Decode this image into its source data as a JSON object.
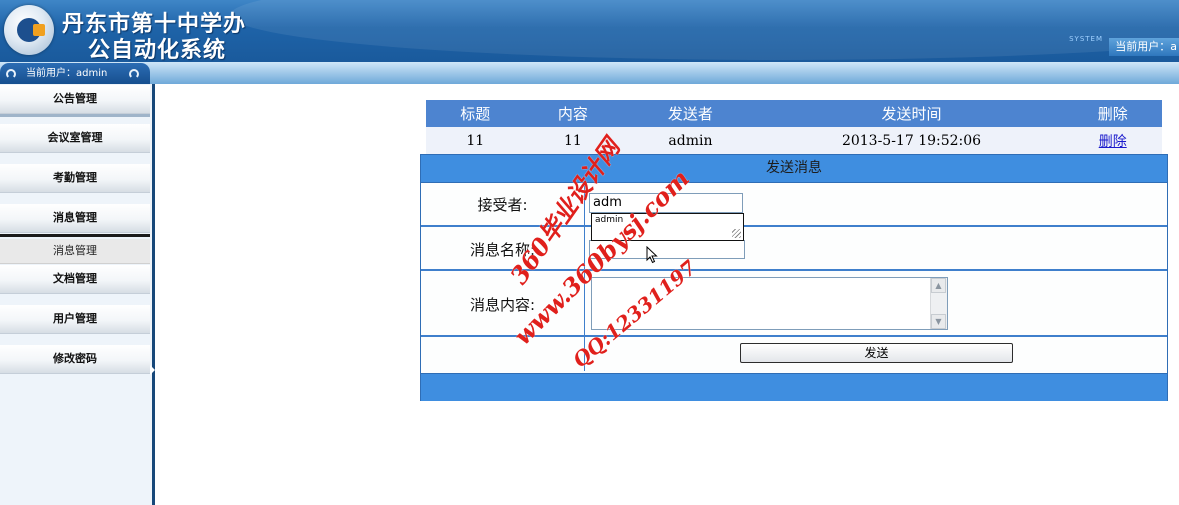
{
  "header": {
    "title_line1": "丹东市第十中学办",
    "title_line2": "公自动化系统",
    "system_badge": "SYSTEM",
    "current_user_label": "当前用户：a"
  },
  "subbar": {
    "current_user": "当前用户：admin"
  },
  "sidebar": {
    "items": [
      {
        "label": "公告管理"
      },
      {
        "label": "会议室管理"
      },
      {
        "label": "考勤管理"
      },
      {
        "label": "消息管理"
      },
      {
        "label": "文档管理"
      },
      {
        "label": "用户管理"
      },
      {
        "label": "修改密码"
      }
    ],
    "submenu": [
      {
        "label": "消息管理"
      }
    ]
  },
  "message_table": {
    "headers": [
      "标题",
      "内容",
      "发送者",
      "发送时间",
      "删除"
    ],
    "rows": [
      {
        "title": "11",
        "content": "11",
        "sender": "admin",
        "time": "2013-5-17 19:52:06",
        "delete": "删除"
      }
    ]
  },
  "send_form": {
    "heading": "发送消息",
    "receiver_label": "接受者:",
    "receiver_value": "adm",
    "autocomplete_option": "admin",
    "title_label": "消息名称:",
    "content_label": "消息内容:",
    "send_button": "发送"
  },
  "watermark": {
    "line1": "360毕业设计网",
    "line2": "www.360bysj.com",
    "line3": "QQ:12331197"
  },
  "colors": {
    "header_blue": "#1e63a8",
    "table_header": "#4d84d0",
    "form_bar": "#3f8ee0",
    "watermark_red": "#e0201c"
  }
}
